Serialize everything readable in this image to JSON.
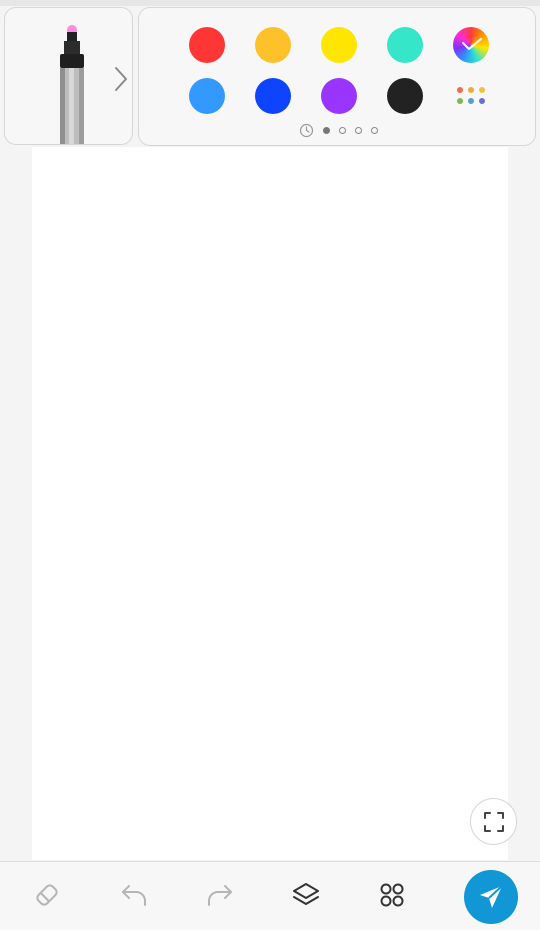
{
  "pen": {
    "tool_icon": "marker-pen-icon",
    "tip_color": "#ff8be0",
    "expand_icon": "chevron-right-icon"
  },
  "palette": {
    "row1": [
      {
        "name": "red",
        "color": "#ff3636"
      },
      {
        "name": "orange",
        "color": "#ffc12a"
      },
      {
        "name": "yellow",
        "color": "#ffe600"
      },
      {
        "name": "teal",
        "color": "#35e6c8"
      }
    ],
    "row2": [
      {
        "name": "sky-blue",
        "color": "#3399ff"
      },
      {
        "name": "blue",
        "color": "#0f44ff"
      },
      {
        "name": "purple",
        "color": "#9a35ff"
      },
      {
        "name": "black",
        "color": "#222222"
      }
    ],
    "custom_color_icon": "color-wheel-icon",
    "more_colors_icon": "more-colors-icon",
    "pager": {
      "pages": 4,
      "active": 0,
      "history_icon": "clock-icon"
    }
  },
  "canvas": {
    "background": "#ffffff",
    "fullscreen_icon": "fullscreen-icon"
  },
  "toolbar": {
    "tools": [
      "eraser-icon",
      "undo-icon",
      "redo-icon",
      "layers-icon",
      "apps-grid-icon"
    ],
    "send_icon": "send-icon",
    "send_color": "#1196d6"
  }
}
